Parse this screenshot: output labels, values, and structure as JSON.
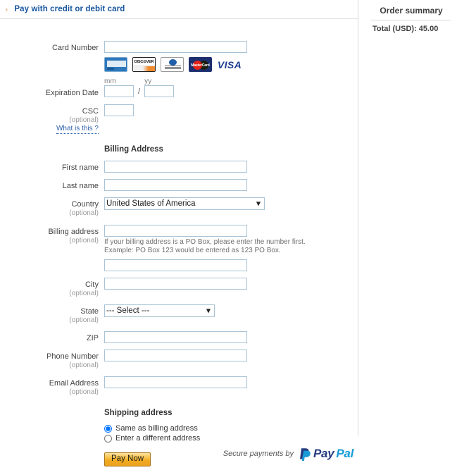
{
  "header": {
    "chevron_icon": "chevron-right-icon",
    "title": "Pay with credit or debit card"
  },
  "form": {
    "card_number": {
      "label": "Card Number",
      "value": "",
      "placeholder": ""
    },
    "accepted_cards": [
      {
        "name": "american-express",
        "label": "AMERICAN EXPRESS"
      },
      {
        "name": "discover",
        "label": "DISCOVER"
      },
      {
        "name": "diners-club",
        "label": "Diners Club International"
      },
      {
        "name": "mastercard",
        "label": "MasterCard"
      },
      {
        "name": "visa",
        "label": "VISA"
      }
    ],
    "expiration": {
      "label": "Expiration Date",
      "month_hint": "mm",
      "year_hint": "yy",
      "separator": "/",
      "month_value": "",
      "year_value": ""
    },
    "csc": {
      "label": "CSC",
      "optional": "(optional)",
      "help_link": "What is this ?",
      "value": ""
    },
    "billing_address_title": "Billing Address",
    "first_name": {
      "label": "First name",
      "value": ""
    },
    "last_name": {
      "label": "Last name",
      "value": ""
    },
    "country": {
      "label": "Country",
      "optional": "(optional)",
      "selected": "United States of America",
      "options": [
        "United States of America"
      ],
      "arrow_icon": "chevron-down-icon"
    },
    "billing_address": {
      "label": "Billing address",
      "optional": "(optional)",
      "line1_value": "",
      "line2_value": "",
      "hint": "If your billing address is a PO Box, please enter the number first. Example: PO Box 123 would be entered as 123 PO Box."
    },
    "city": {
      "label": "City",
      "optional": "(optional)",
      "value": ""
    },
    "state": {
      "label": "State",
      "optional": "(optional)",
      "selected": "--- Select ---",
      "options": [
        "--- Select ---"
      ],
      "arrow_icon": "chevron-down-icon"
    },
    "zip": {
      "label": "ZIP",
      "value": ""
    },
    "phone": {
      "label": "Phone Number",
      "optional": "(optional)",
      "value": ""
    },
    "email": {
      "label": "Email Address",
      "optional": "(optional)",
      "value": ""
    },
    "shipping": {
      "title": "Shipping address",
      "option_same": "Same as billing address",
      "option_different": "Enter a different address",
      "selected": "same"
    },
    "submit_label": "Pay Now"
  },
  "order_summary": {
    "title": "Order summary",
    "total_label": "Total (USD): 45.00"
  },
  "footer": {
    "secure_text": "Secure payments by",
    "brand_first": "Pay",
    "brand_second": "Pal",
    "brand_icon": "paypal-logo-icon",
    "brand_color_dark": "#253b80",
    "brand_color_light": "#179bd7"
  }
}
